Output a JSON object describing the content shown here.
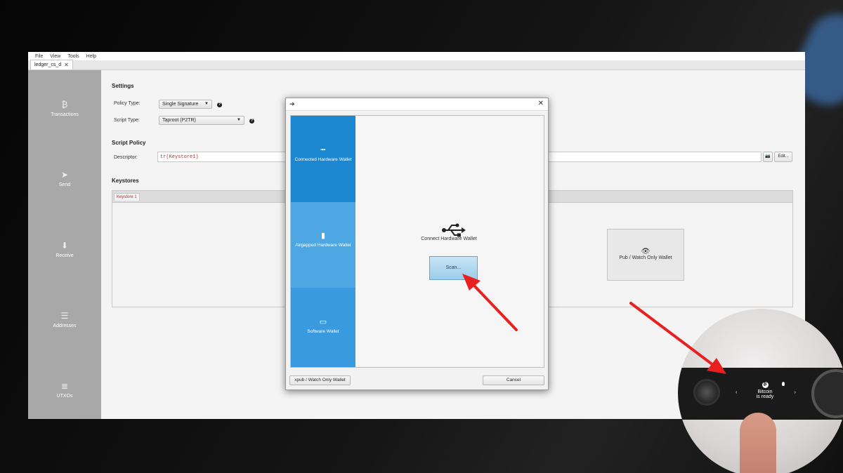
{
  "menu": [
    "File",
    "View",
    "Tools",
    "Help"
  ],
  "tab": {
    "label": "ledger_cs_d"
  },
  "sidebar": [
    {
      "label": "Transactions",
      "icon": "bitcoin-icon"
    },
    {
      "label": "Send",
      "icon": "send-icon"
    },
    {
      "label": "Receive",
      "icon": "receive-icon"
    },
    {
      "label": "Addresses",
      "icon": "list-icon"
    },
    {
      "label": "UTXOs",
      "icon": "coins-icon"
    }
  ],
  "settings": {
    "heading": "Settings",
    "policy_type_label": "Policy Type:",
    "policy_type_value": "Single Signature",
    "script_type_label": "Script Type:",
    "script_type_value": "Taproot (P2TR)"
  },
  "script_policy": {
    "heading": "Script Policy",
    "descriptor_label": "Descriptor:",
    "descriptor_value": "tr(Keystore1)",
    "edit_label": "Edit..."
  },
  "keystores": {
    "heading": "Keystores",
    "tab_label": "Keystore 1",
    "xpub_card_label": "Pub / Watch Only Wallet"
  },
  "dialog": {
    "options": [
      {
        "label": "Connected Hardware Wallet",
        "icon": "usb-icon",
        "color": "#1b87d0"
      },
      {
        "label": "Airgapped Hardware Wallet",
        "icon": "sd-card-icon",
        "color": "#4ea7e3"
      },
      {
        "label": "Software Wallet",
        "icon": "laptop-icon",
        "color": "#3a9ae0"
      }
    ],
    "content_label": "Connect Hardware Wallet",
    "scan_label": "Scan...",
    "xpub_button": "xpub / Watch Only Wallet",
    "cancel_button": "Cancel"
  },
  "device": {
    "line1": "Bitcoin",
    "line2": "is ready"
  },
  "colors": {
    "accent_blue": "#1b87d0",
    "arrow_red": "#e8201f",
    "sidebar_gray": "#a8a8a8"
  }
}
